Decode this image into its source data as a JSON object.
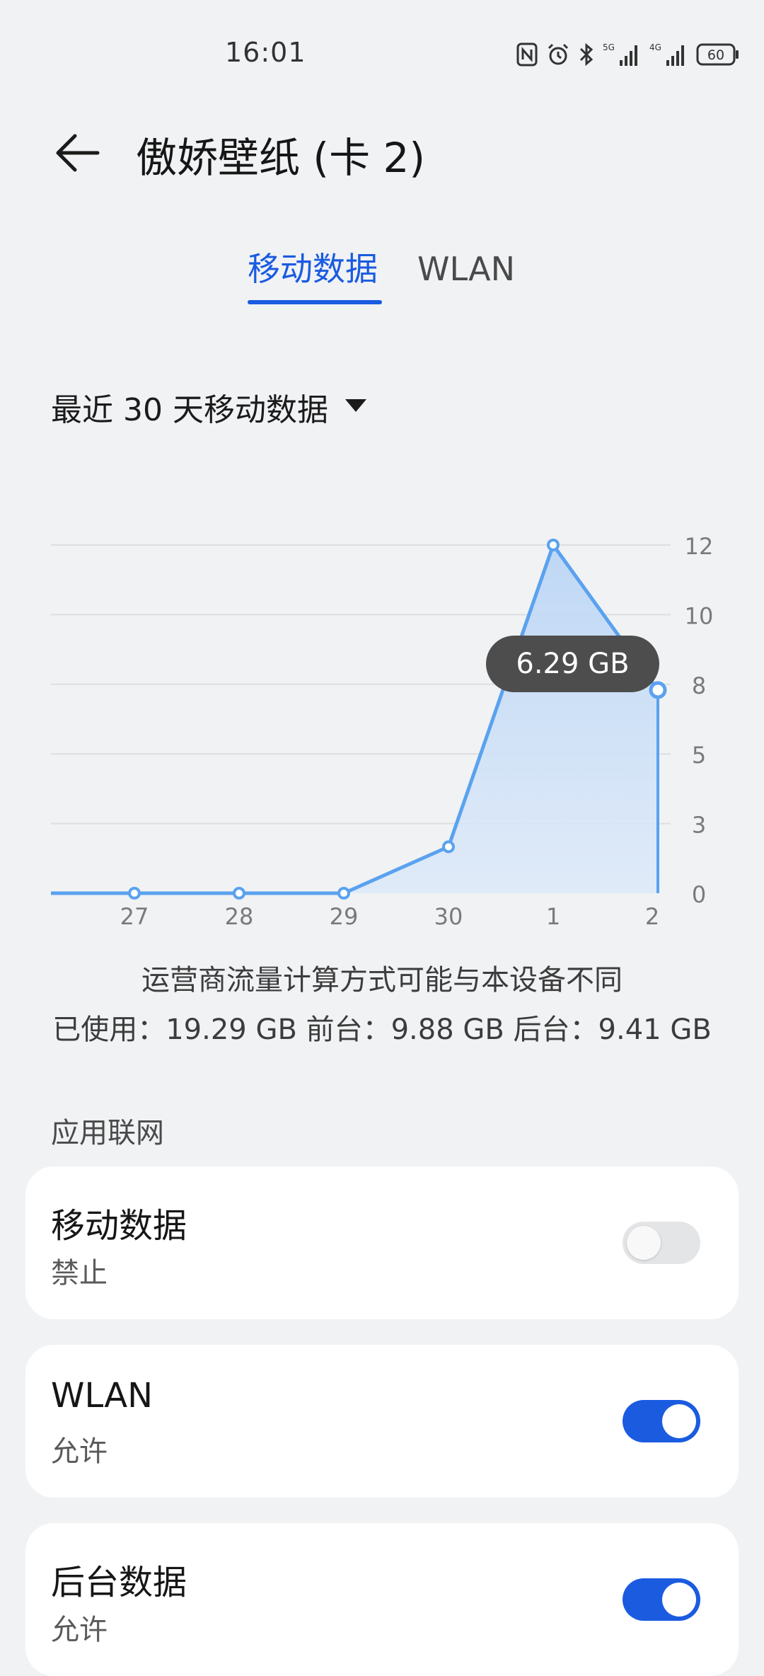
{
  "status_bar": {
    "time": "16:01",
    "icons": [
      "nfc-icon",
      "alarm-icon",
      "bluetooth-icon",
      "5g-signal-icon",
      "4g-signal-icon",
      "battery-icon"
    ],
    "signal_1_label": "5G",
    "signal_2_label": "4G",
    "battery_level": "60"
  },
  "header": {
    "back_icon": "arrow-left-icon",
    "title": "傲娇壁纸 (卡 2)"
  },
  "tabs": [
    {
      "label": "移动数据",
      "active": true
    },
    {
      "label": "WLAN",
      "active": false
    }
  ],
  "period": {
    "label": "最近 30 天移动数据",
    "icon": "dropdown-triangle-icon"
  },
  "chart_data": {
    "type": "area",
    "categories": [
      "27",
      "28",
      "29",
      "30",
      "1",
      "2"
    ],
    "values": [
      0,
      0,
      0,
      1.6,
      12,
      7.0
    ],
    "ylim": [
      0,
      12
    ],
    "yticks": [
      "0",
      "3",
      "5",
      "8",
      "10",
      "12"
    ],
    "grid": true,
    "line_color": "#5aa2ef",
    "fill_color": "#c5dcf6",
    "tooltip": "6.29 GB"
  },
  "summary": {
    "note": "运营商流量计算方式可能与本设备不同",
    "usage": "已使用：19.29 GB 前台：9.88 GB 后台：9.41 GB"
  },
  "section": {
    "label": "应用联网"
  },
  "cards": [
    {
      "title": "移动数据",
      "status": "禁止",
      "enabled": false
    },
    {
      "title": "WLAN",
      "status": "允许",
      "enabled": true
    },
    {
      "title": "后台数据",
      "status": "允许",
      "enabled": true
    }
  ],
  "colors": {
    "accent": "#1a5be0",
    "background": "#f1f2f4",
    "card": "#ffffff",
    "tooltip": "#4d4d4d"
  }
}
